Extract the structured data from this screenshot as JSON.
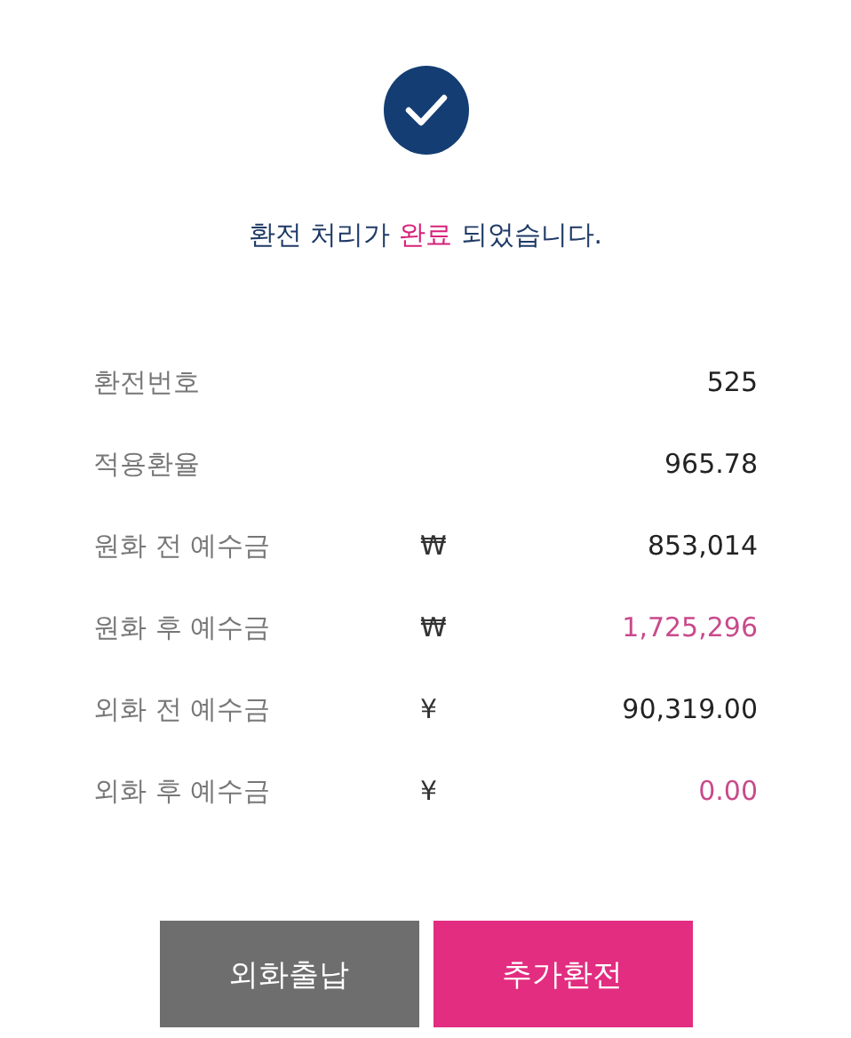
{
  "status": {
    "done": true
  },
  "message": [
    {
      "text": "환전 처리가 ",
      "highlight": false
    },
    {
      "text": "완료",
      "highlight": true
    },
    {
      "text": " 되었습니다.",
      "highlight": false
    }
  ],
  "details": [
    {
      "label": "환전번호",
      "value": "525",
      "highlight": false
    },
    {
      "label": "적용환율",
      "value": "965.78",
      "highlight": false
    },
    {
      "label": "원화 전 예수금",
      "currency": "₩",
      "value": "853,014",
      "highlight": false
    },
    {
      "label": "원화 후 예수금",
      "currency": "₩",
      "value": "1,725,296",
      "highlight": true
    },
    {
      "label": "외화 전 예수금",
      "currency": "¥",
      "value": "90,319.00",
      "highlight": false
    },
    {
      "label": "외화 후 예수금",
      "currency": "¥",
      "value": "0.00",
      "highlight": true
    }
  ],
  "buttons": [
    {
      "label": "외화출납",
      "kind": "secondary"
    },
    {
      "label": "추가환전",
      "kind": "primary"
    }
  ]
}
